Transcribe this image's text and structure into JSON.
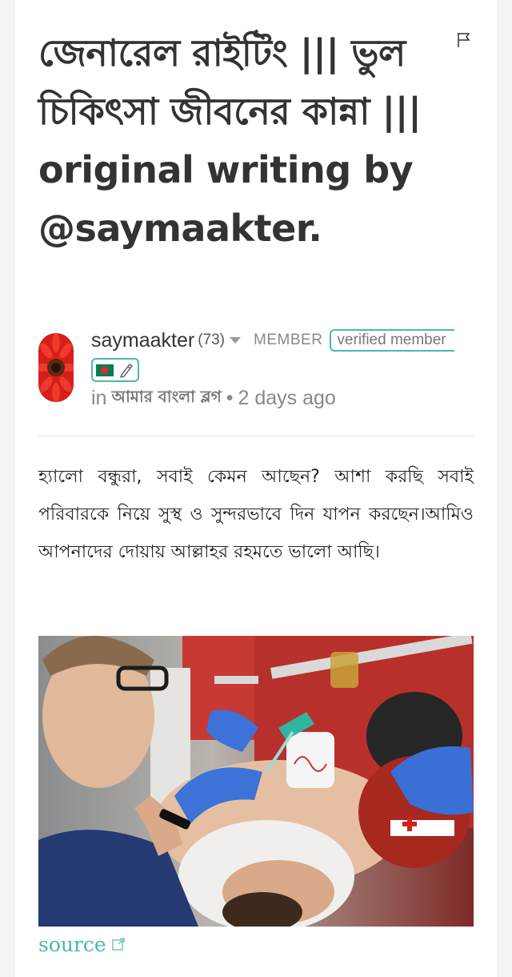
{
  "post": {
    "title": "জেনারেল রাইটিং ||| ভুল চিকিৎসা জীবনের কান্না ||| original writing by @saymaakter.",
    "author": {
      "name": "saymaakter",
      "reputation": "(73)",
      "role": "MEMBER",
      "verified_label": "verified member"
    },
    "community": {
      "prefix": "in",
      "name": "আমার বাংলা ব্লগ",
      "separator": "•",
      "time_ago": "2 days ago"
    },
    "intro_text": "হ্যালো বন্ধুরা, সবাই কেমন আছেন? আশা করছি সবাই পরিবারকে নিয়ে সুস্থ ও সুন্দরভাবে দিন যাপন করছেন।আমিও আপনাদের দোয়ায় আল্লাহর রহমতে ভালো আছি।",
    "source_label": "source"
  },
  "icons": {
    "flag": "flag-icon",
    "dropdown": "chevron-down-icon",
    "country_flag": "bangladesh-flag-icon",
    "pen": "pen-icon",
    "external_link": "external-link-icon"
  },
  "colors": {
    "accent": "#4bb9a6",
    "title": "#333333",
    "muted": "#888888"
  }
}
